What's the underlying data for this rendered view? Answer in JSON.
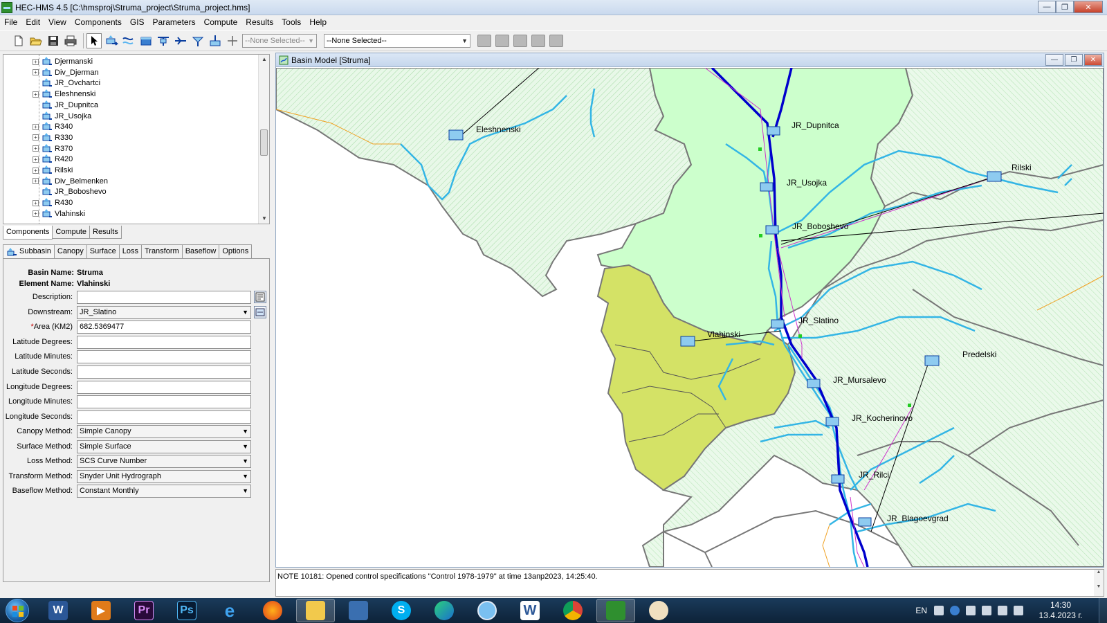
{
  "window": {
    "title": "HEC-HMS 4.5 [C:\\hmsproj\\Struma_project\\Struma_project.hms]"
  },
  "menu": [
    "File",
    "Edit",
    "View",
    "Components",
    "GIS",
    "Parameters",
    "Compute",
    "Results",
    "Tools",
    "Help"
  ],
  "toolbar": {
    "combo1": "--None Selected--",
    "combo2": "--None Selected--"
  },
  "tree": {
    "items": [
      {
        "label": "Djermanski",
        "expandable": true
      },
      {
        "label": "Div_Djerman",
        "expandable": true
      },
      {
        "label": "JR_Ovchartci",
        "expandable": false
      },
      {
        "label": "Eleshnenski",
        "expandable": true
      },
      {
        "label": "JR_Dupnitca",
        "expandable": false
      },
      {
        "label": "JR_Usojka",
        "expandable": false
      },
      {
        "label": "R340",
        "expandable": true
      },
      {
        "label": "R330",
        "expandable": true
      },
      {
        "label": "R370",
        "expandable": true
      },
      {
        "label": "R420",
        "expandable": true
      },
      {
        "label": "Rilski",
        "expandable": true
      },
      {
        "label": "Div_Belmenken",
        "expandable": true
      },
      {
        "label": "JR_Boboshevo",
        "expandable": false
      },
      {
        "label": "R430",
        "expandable": true
      },
      {
        "label": "Vlahinski",
        "expandable": true
      }
    ],
    "tabs": [
      "Components",
      "Compute",
      "Results"
    ]
  },
  "editor": {
    "tabs": [
      "Subbasin",
      "Canopy",
      "Surface",
      "Loss",
      "Transform",
      "Baseflow",
      "Options"
    ],
    "basin_name_label": "Basin Name:",
    "basin_name": "Struma",
    "element_name_label": "Element Name:",
    "element_name": "Vlahinski",
    "description_label": "Description:",
    "description": "",
    "downstream_label": "Downstream:",
    "downstream": "JR_Slatino",
    "area_req": "*",
    "area_label": "Area (KM2)",
    "area": "682.5369477",
    "lat_deg_label": "Latitude Degrees:",
    "lat_min_label": "Latitude Minutes:",
    "lat_sec_label": "Latitude Seconds:",
    "lon_deg_label": "Longitude Degrees:",
    "lon_min_label": "Longitude Minutes:",
    "lon_sec_label": "Longitude Seconds:",
    "canopy_label": "Canopy Method:",
    "canopy": "Simple Canopy",
    "surface_label": "Surface Method:",
    "surface": "Simple Surface",
    "loss_label": "Loss Method:",
    "loss": "SCS Curve Number",
    "transform_label": "Transform Method:",
    "transform": "Snyder Unit Hydrograph",
    "baseflow_label": "Baseflow Method:",
    "baseflow": "Constant Monthly"
  },
  "basin": {
    "title": "Basin Model [Struma]",
    "labels": {
      "eleshnenski": "Eleshnenski",
      "jr_dupnitca": "JR_Dupnitca",
      "jr_usojka": "JR_Usojka",
      "rilski": "Rilski",
      "jr_boboshevo": "JR_Boboshevo",
      "jr_slatino": "JR_Slatino",
      "vlahinski": "Vlahinski",
      "predelski": "Predelski",
      "jr_mursalevo": "JR_Mursalevo",
      "jr_kocherinovo": "JR_Kocherinovo",
      "jr_rilci": "JR_Rilci",
      "jr_blagoevgrad": "JR_Blagoevgrad"
    }
  },
  "message": "NOTE 10181:  Opened control specifications \"Control 1978-1979\" at time 13апр2023, 14:25:40.",
  "taskbar": {
    "lang": "EN",
    "time": "14:30",
    "date": "13.4.2023 г."
  },
  "colors": {
    "accent": "#0000cc",
    "river": "#33b5e5",
    "selected_subbasin": "#d4e266",
    "subbasin_fill": "#ccffcc"
  }
}
